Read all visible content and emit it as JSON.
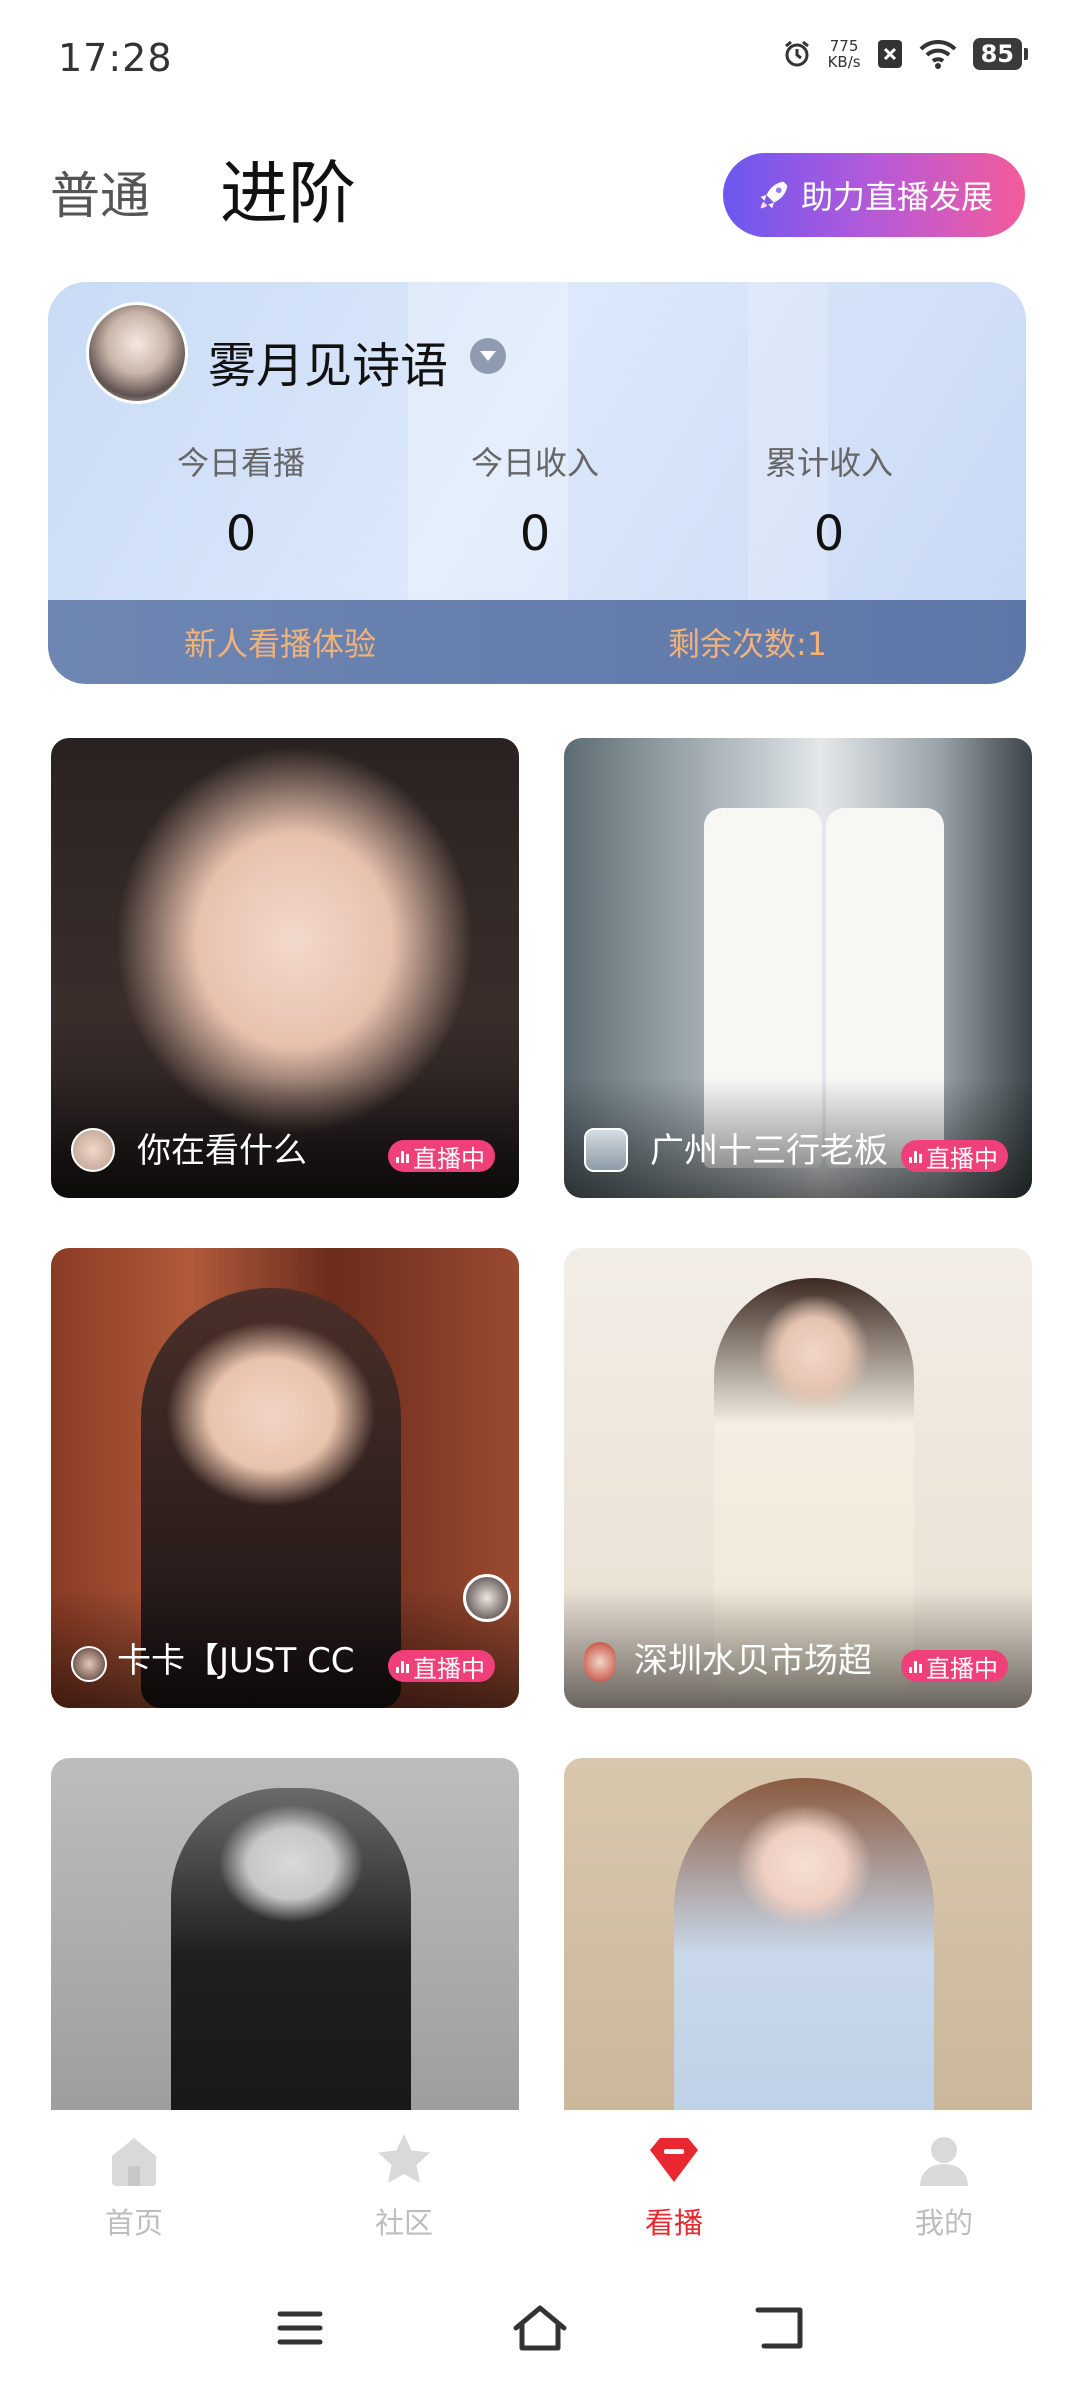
{
  "status_bar": {
    "time": "17:28",
    "net_speed_value": "775",
    "net_speed_unit": "KB/s",
    "battery": "85",
    "icons": [
      "alarm-icon",
      "no-sim-icon",
      "wifi-icon",
      "battery-icon"
    ]
  },
  "header": {
    "tab_normal": "普通",
    "tab_advanced": "进阶",
    "boost_button": "助力直播发展",
    "boost_icon": "rocket-icon"
  },
  "info_card": {
    "username": "雾月见诗语",
    "stats": [
      {
        "label": "今日看播",
        "value": "0"
      },
      {
        "label": "今日收入",
        "value": "0"
      },
      {
        "label": "累计收入",
        "value": "0"
      }
    ],
    "footer_left": "新人看播体验",
    "footer_right": "剩余次数:1"
  },
  "live_badge": "直播中",
  "live_cards": [
    {
      "name": "你在看什么"
    },
    {
      "name": "广州十三行老板"
    },
    {
      "name": "卡卡【JUST CC"
    },
    {
      "name": "深圳水贝市场超"
    }
  ],
  "bottom_nav": [
    {
      "label": "首页",
      "icon": "home-icon"
    },
    {
      "label": "社区",
      "icon": "star-icon"
    },
    {
      "label": "看播",
      "icon": "live-watch-icon"
    },
    {
      "label": "我的",
      "icon": "profile-icon"
    }
  ],
  "colors": {
    "accent_red": "#e8272f",
    "live_badge_pink": "#f0407a",
    "footer_text_orange": "#f0b27a",
    "boost_gradient_start": "#6b57f0",
    "boost_gradient_end": "#f45b9a"
  }
}
